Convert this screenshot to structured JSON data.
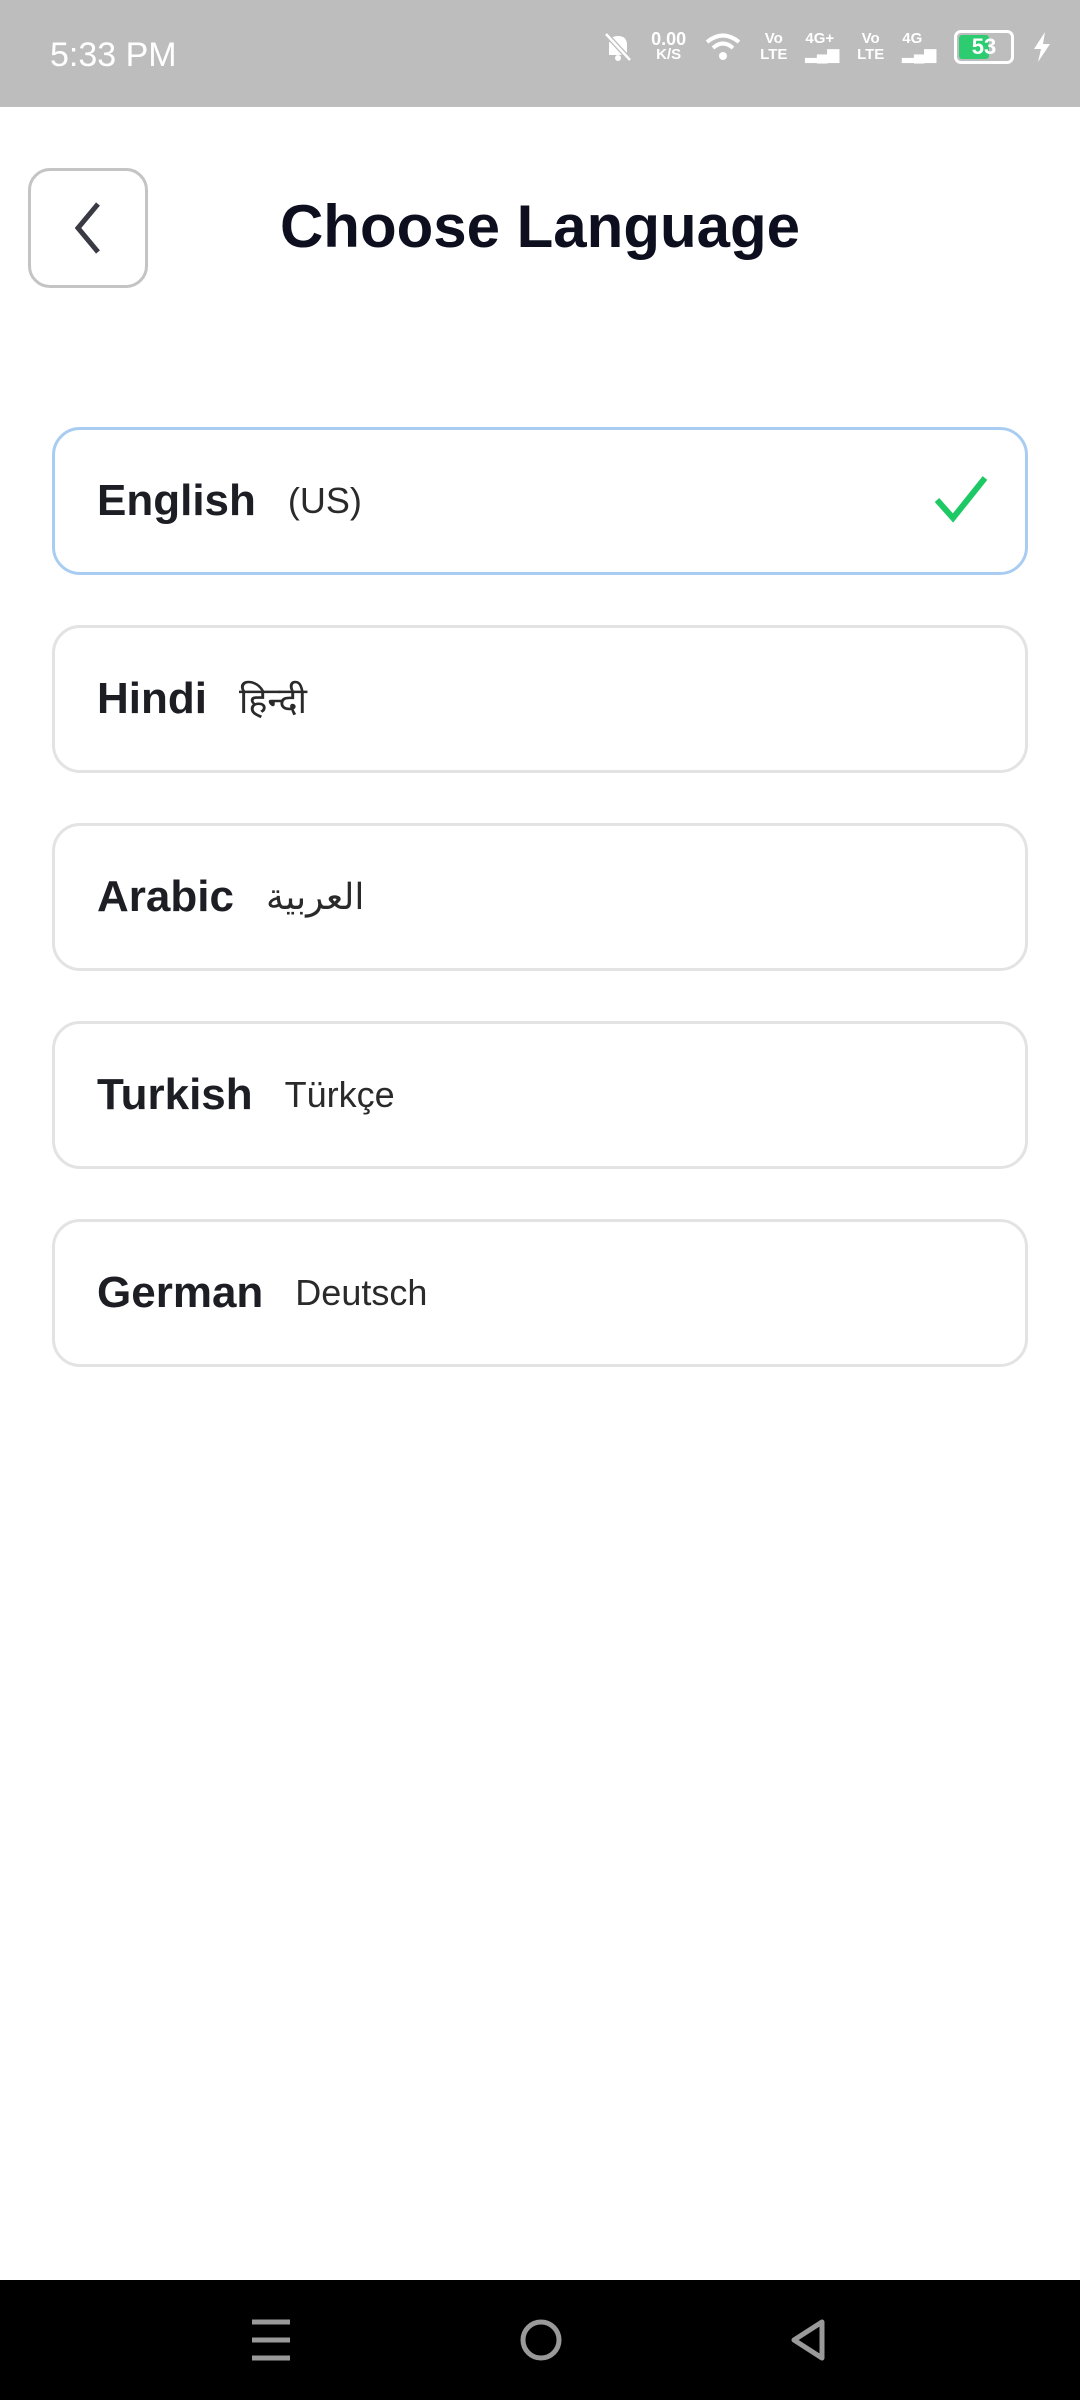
{
  "status_bar": {
    "time": "5:33 PM",
    "net_speed": "0.00",
    "net_unit": "K/S",
    "sim1_type": "Vo",
    "sim1_sub": "LTE",
    "sim1_net": "4G+",
    "sim2_type": "Vo",
    "sim2_sub": "LTE",
    "sim2_net": "4G",
    "battery": "53"
  },
  "header": {
    "title": "Choose Language"
  },
  "languages": [
    {
      "name": "English",
      "native": "(US)",
      "selected": true
    },
    {
      "name": "Hindi",
      "native": "हिन्दी",
      "selected": false
    },
    {
      "name": "Arabic",
      "native": "العربية",
      "selected": false
    },
    {
      "name": "Turkish",
      "native": "Türkçe",
      "selected": false
    },
    {
      "name": "German",
      "native": "Deutsch",
      "selected": false
    }
  ],
  "colors": {
    "check": "#1dc964",
    "selected_border": "#a9cdf2"
  }
}
